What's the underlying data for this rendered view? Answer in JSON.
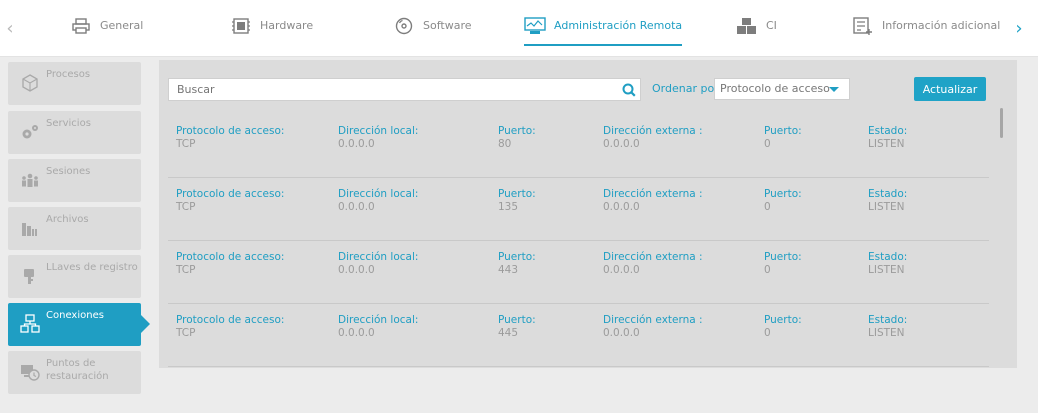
{
  "tabs": [
    {
      "label": "General",
      "icon": "printer-icon"
    },
    {
      "label": "Hardware",
      "icon": "chip-icon"
    },
    {
      "label": "Software",
      "icon": "disc-icon"
    },
    {
      "label": "Administración Remota",
      "icon": "monitor-icon"
    },
    {
      "label": "CI",
      "icon": "boxes-icon"
    },
    {
      "label": "Información adicional",
      "icon": "note-add-icon"
    }
  ],
  "sidebar": {
    "items": [
      {
        "label": "Procesos"
      },
      {
        "label": "Servicios"
      },
      {
        "label": "Sesiones"
      },
      {
        "label": "Archivos"
      },
      {
        "label": "LLaves de registro"
      },
      {
        "label": "Conexiones"
      },
      {
        "label_line1": "Puntos de",
        "label_line2": "restauración"
      }
    ]
  },
  "toolbar": {
    "search_placeholder": "Buscar",
    "order_label": "Ordenar por:",
    "order_value": "Protocolo de acceso",
    "refresh_label": "Actualizar"
  },
  "headers": {
    "protocol": "Protocolo de acceso:",
    "local": "Dirección local:",
    "port": "Puerto:",
    "external": "Dirección externa :",
    "port2": "Puerto:",
    "state": "Estado:"
  },
  "rows": [
    {
      "protocol": "TCP",
      "local": "0.0.0.0",
      "port": "80",
      "external": "0.0.0.0",
      "port2": "0",
      "state": "LISTEN"
    },
    {
      "protocol": "TCP",
      "local": "0.0.0.0",
      "port": "135",
      "external": "0.0.0.0",
      "port2": "0",
      "state": "LISTEN"
    },
    {
      "protocol": "TCP",
      "local": "0.0.0.0",
      "port": "443",
      "external": "0.0.0.0",
      "port2": "0",
      "state": "LISTEN"
    },
    {
      "protocol": "TCP",
      "local": "0.0.0.0",
      "port": "445",
      "external": "0.0.0.0",
      "port2": "0",
      "state": "LISTEN"
    }
  ],
  "colors": {
    "accent": "#1f9ec3",
    "panel": "#dcdcdc",
    "muted": "#9b9b9b"
  }
}
